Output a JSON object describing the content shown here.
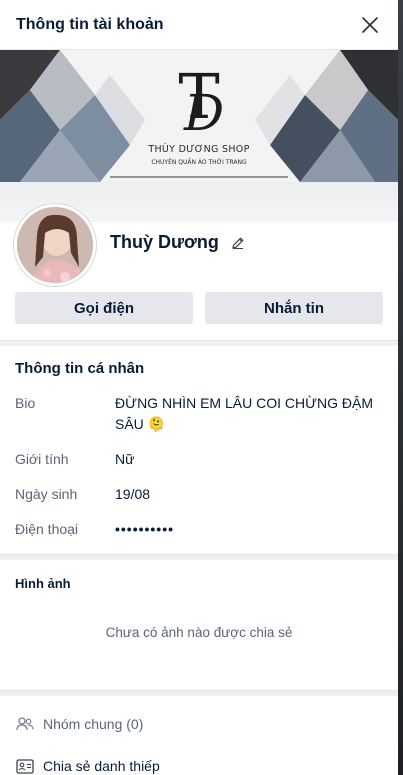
{
  "header": {
    "title": "Thông tin tài khoản"
  },
  "cover": {
    "brand_name": "THÙY DƯƠNG SHOP",
    "brand_tagline": "CHUYÊN QUẦN ÁO THỜI TRANG",
    "logo_letters": "TD"
  },
  "profile": {
    "name": "Thuỳ Dương"
  },
  "actions": {
    "call_label": "Gọi điện",
    "message_label": "Nhắn tin"
  },
  "personal": {
    "title": "Thông tin cá nhân",
    "rows": [
      {
        "label": "Bio",
        "value": "ĐỪNG NHÌN EM LÂU COI CHỪNG ĐẬM SÂU 🫠"
      },
      {
        "label": "Giới tính",
        "value": "Nữ"
      },
      {
        "label": "Ngày sinh",
        "value": "19/08"
      },
      {
        "label": "Điện thoại",
        "value": "••••••••••"
      }
    ]
  },
  "images": {
    "title": "Hình ảnh",
    "empty_text": "Chưa có ảnh nào được chia sẻ"
  },
  "links": {
    "common_groups": "Nhóm chung (0)",
    "share_card": "Chia sẻ danh thiếp"
  },
  "icons": [
    "close-icon",
    "edit-icon",
    "group-icon",
    "contact-card-icon"
  ]
}
